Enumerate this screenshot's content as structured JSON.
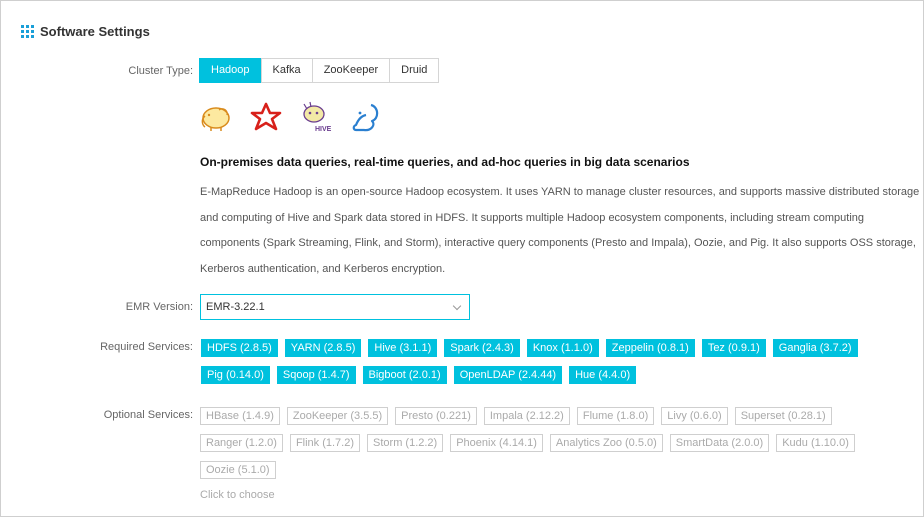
{
  "header": {
    "title": "Software Settings"
  },
  "cluster_type": {
    "label": "Cluster Type:",
    "tabs": [
      {
        "label": "Hadoop",
        "active": true
      },
      {
        "label": "Kafka",
        "active": false
      },
      {
        "label": "ZooKeeper",
        "active": false
      },
      {
        "label": "Druid",
        "active": false
      }
    ]
  },
  "logos": [
    "hadoop-elephant-logo",
    "spark-star-logo",
    "hive-bee-logo",
    "squirrel-logo"
  ],
  "description": {
    "title": "On-premises data queries, real-time queries, and ad-hoc queries in big data scenarios",
    "body": "E-MapReduce Hadoop is an open-source Hadoop ecosystem. It uses YARN to manage cluster resources, and supports massive distributed storage and computing of Hive and Spark data stored in HDFS. It supports multiple Hadoop ecosystem components, including stream computing components (Spark Streaming, Flink, and Storm), interactive query components (Presto and Impala), Oozie, and Pig. It also supports OSS storage, Kerberos authentication, and Kerberos encryption."
  },
  "emr_version": {
    "label": "EMR Version:",
    "value": "EMR-3.22.1"
  },
  "required_services": {
    "label": "Required Services:",
    "items": [
      "HDFS (2.8.5)",
      "YARN (2.8.5)",
      "Hive (3.1.1)",
      "Spark (2.4.3)",
      "Knox (1.1.0)",
      "Zeppelin (0.8.1)",
      "Tez (0.9.1)",
      "Ganglia (3.7.2)",
      "Pig (0.14.0)",
      "Sqoop (1.4.7)",
      "Bigboot (2.0.1)",
      "OpenLDAP (2.4.44)",
      "Hue (4.4.0)"
    ]
  },
  "optional_services": {
    "label": "Optional Services:",
    "items": [
      "HBase (1.4.9)",
      "ZooKeeper (3.5.5)",
      "Presto (0.221)",
      "Impala (2.12.2)",
      "Flume (1.8.0)",
      "Livy (0.6.0)",
      "Superset (0.28.1)",
      "Ranger (1.2.0)",
      "Flink (1.7.2)",
      "Storm (1.2.2)",
      "Phoenix (4.14.1)",
      "Analytics Zoo (0.5.0)",
      "SmartData (2.0.0)",
      "Kudu (1.10.0)",
      "Oozie (5.1.0)"
    ],
    "hint": "Click to choose"
  },
  "colors": {
    "accent": "#00c1de",
    "heading_icon": "#1a9fd8"
  }
}
